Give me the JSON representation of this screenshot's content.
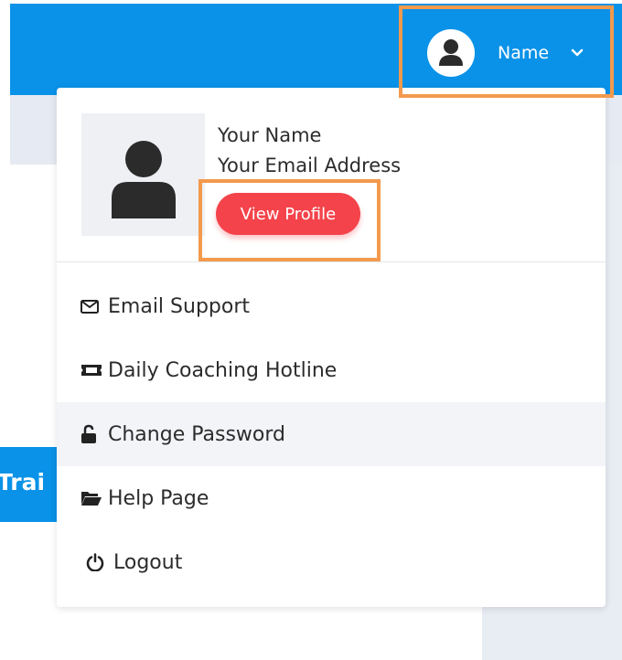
{
  "header": {
    "user_button": {
      "name": "Name"
    }
  },
  "background": {
    "blue_button_label": "Trai"
  },
  "dropdown": {
    "profile": {
      "name": "Your Name",
      "email": "Your Email Address",
      "view_profile_label": "View Profile"
    },
    "items": [
      {
        "label": "Email Support",
        "icon": "envelope-icon"
      },
      {
        "label": "Daily Coaching Hotline",
        "icon": "ticket-icon"
      },
      {
        "label": "Change Password",
        "icon": "unlock-icon"
      },
      {
        "label": "Help Page",
        "icon": "folder-open-icon"
      },
      {
        "label": "Logout",
        "icon": "power-icon"
      }
    ]
  },
  "colors": {
    "topbar": "#0a92e8",
    "view_profile_button": "#f4434a",
    "highlight_outline": "#f39a4d",
    "active_item_bg": "#f2f4f7"
  }
}
